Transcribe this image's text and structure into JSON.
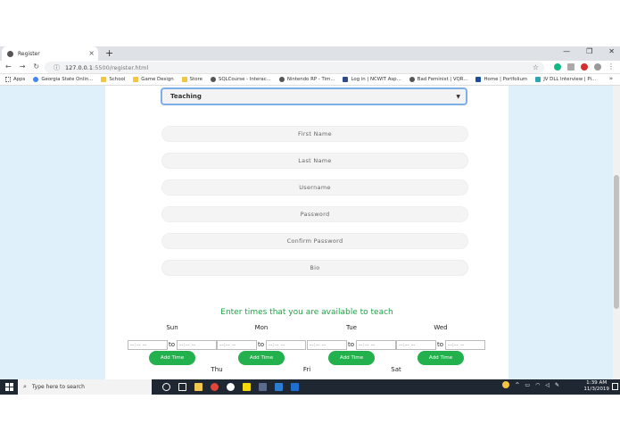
{
  "browser": {
    "tab_title": "Register",
    "tab_close": "×",
    "new_tab": "+",
    "window_controls": {
      "minimize": "—",
      "restore": "❐",
      "close": "✕"
    },
    "nav": {
      "back": "←",
      "forward": "→",
      "reload": "↻"
    },
    "url_host": "127.0.0.1",
    "url_path": ":5500/register.html",
    "bookmark_star": "☆",
    "bookmarks_more": "»",
    "bookmarks": [
      {
        "label": "Apps",
        "icon": "apps-grid-icon"
      },
      {
        "label": "Georgia State Onlin...",
        "icon": "google-icon"
      },
      {
        "label": "School",
        "icon": "folder-icon"
      },
      {
        "label": "Game Design",
        "icon": "folder-icon"
      },
      {
        "label": "Store",
        "icon": "folder-icon"
      },
      {
        "label": "SQLCourse - Interac...",
        "icon": "site-icon"
      },
      {
        "label": "Nintendo RP - Tim...",
        "icon": "site-icon"
      },
      {
        "label": "Log in | NCWIT Asp...",
        "icon": "ncwit-icon"
      },
      {
        "label": "Bad Feminist | VQR...",
        "icon": "site-icon"
      },
      {
        "label": "Home | Portfolium",
        "icon": "portfolium-icon"
      },
      {
        "label": "JV DLL Interview | Pi...",
        "icon": "site-icon"
      }
    ]
  },
  "form": {
    "role_select": "Teaching",
    "fields": [
      {
        "placeholder": "First Name"
      },
      {
        "placeholder": "Last Name"
      },
      {
        "placeholder": "Username"
      },
      {
        "placeholder": "Password"
      },
      {
        "placeholder": "Confirm Password"
      },
      {
        "placeholder": "Bio"
      }
    ]
  },
  "availability": {
    "heading": "Enter times that you are available to teach",
    "time_placeholder": "--:-- --",
    "to_label": "to",
    "add_label": "Add Time",
    "days_row1": [
      "Sun",
      "Mon",
      "Tue",
      "Wed"
    ],
    "days_row2": [
      "Thu",
      "Fri",
      "Sat"
    ]
  },
  "taskbar": {
    "search_placeholder": "Type here to search",
    "time": "1:39 AM",
    "date": "11/3/2019"
  },
  "colors": {
    "accent_green": "#22b14c",
    "heading_green": "#21a348",
    "page_bg": "#dff0fb",
    "taskbar": "#1f2733"
  }
}
